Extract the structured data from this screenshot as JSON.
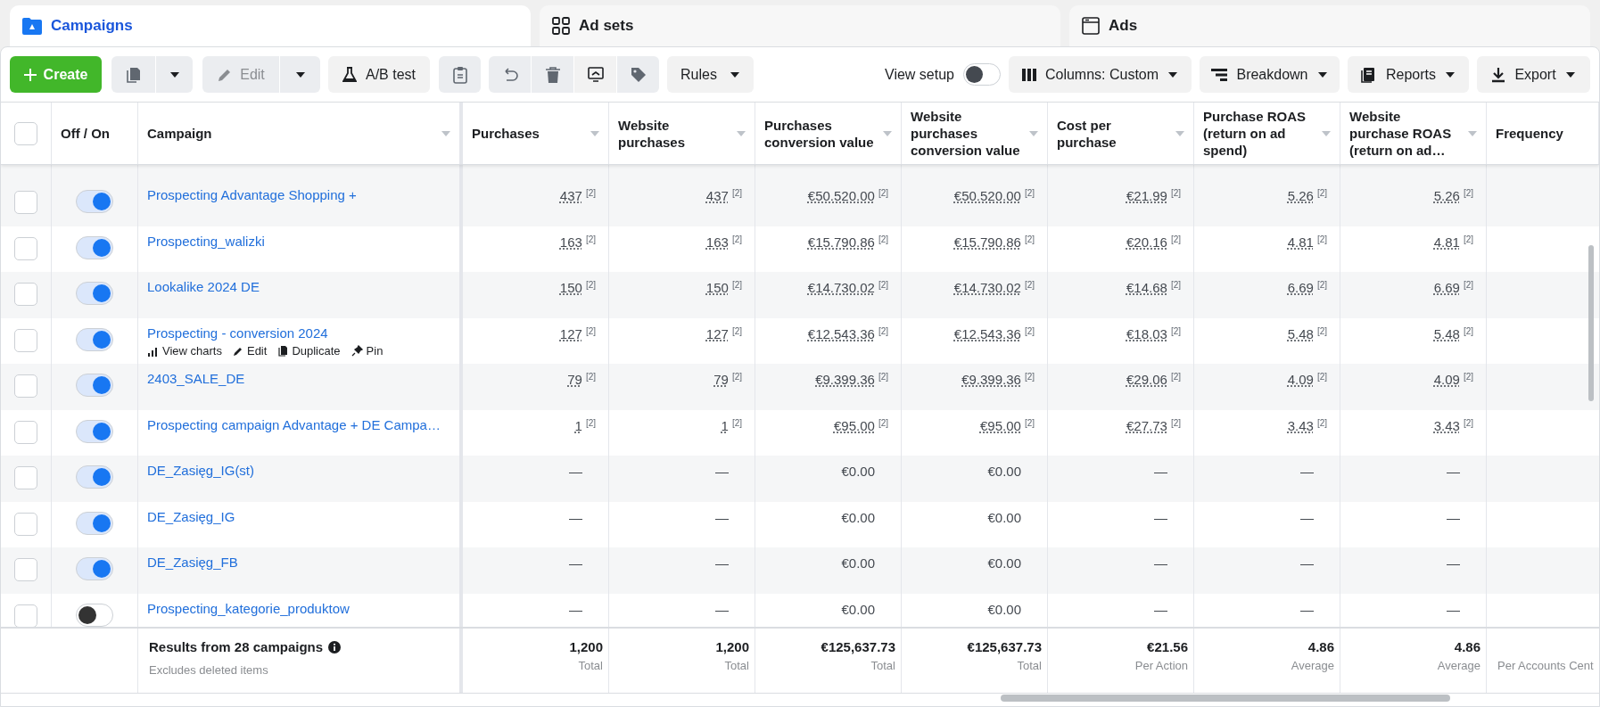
{
  "tabs": [
    {
      "label": "Campaigns",
      "selected": true
    },
    {
      "label": "Ad sets",
      "selected": false
    },
    {
      "label": "Ads",
      "selected": false
    }
  ],
  "toolbar": {
    "create": "Create",
    "edit": {
      "label": "Edit",
      "disabled": true
    },
    "ab_test": "A/B test",
    "rules": "Rules",
    "view_setup": {
      "label": "View setup",
      "on": false
    },
    "right_buttons": [
      "Columns: Custom",
      "Breakdown",
      "Reports",
      "Export"
    ]
  },
  "table": {
    "header_checkbox": {
      "checked": false
    },
    "toggle_header": {
      "label": "Off / On",
      "sortable": false
    },
    "name_header": {
      "label": "Campaign",
      "sortable": true
    },
    "columns": [
      {
        "label": "Purchases",
        "sortable": true
      },
      {
        "label": "Website purchases",
        "sortable": true
      },
      {
        "label": "Purchases conversion value",
        "sortable": true
      },
      {
        "label": "Website purchases conversion value",
        "sortable": true
      },
      {
        "label": "Cost per purchase",
        "sortable": true
      },
      {
        "label": "Purchase ROAS (return on ad spend)",
        "sortable": true
      },
      {
        "label": "Website purchase ROAS (return on ad…",
        "sortable": true
      },
      {
        "label": "Frequency",
        "sortable": false
      }
    ],
    "rows": [
      {
        "name": "Prospecting Advantage Shopping +",
        "on": true,
        "checked": false,
        "cells": [
          {
            "value": "437",
            "note": "[2]"
          },
          {
            "value": "437",
            "note": "[2]"
          },
          {
            "value": "€50.520.00",
            "note": "[2]"
          },
          {
            "value": "€50.520.00",
            "note": "[2]"
          },
          {
            "value": "€21.99",
            "note": "[2]"
          },
          {
            "value": "5.26",
            "note": "[2]"
          },
          {
            "value": "5.26",
            "note": "[2]"
          }
        ]
      },
      {
        "name": "Prospecting_walizki",
        "on": true,
        "checked": false,
        "cells": [
          {
            "value": "163",
            "note": "[2]"
          },
          {
            "value": "163",
            "note": "[2]"
          },
          {
            "value": "€15.790.86",
            "note": "[2]"
          },
          {
            "value": "€15.790.86",
            "note": "[2]"
          },
          {
            "value": "€20.16",
            "note": "[2]"
          },
          {
            "value": "4.81",
            "note": "[2]"
          },
          {
            "value": "4.81",
            "note": "[2]"
          }
        ]
      },
      {
        "name": "Lookalike 2024 DE",
        "on": true,
        "checked": false,
        "cells": [
          {
            "value": "150",
            "note": "[2]"
          },
          {
            "value": "150",
            "note": "[2]"
          },
          {
            "value": "€14.730.02",
            "note": "[2]"
          },
          {
            "value": "€14.730.02",
            "note": "[2]"
          },
          {
            "value": "€14.68",
            "note": "[2]"
          },
          {
            "value": "6.69",
            "note": "[2]"
          },
          {
            "value": "6.69",
            "note": "[2]"
          }
        ]
      },
      {
        "name": "Prospecting - conversion 2024",
        "on": true,
        "checked": false,
        "actions": [
          "View charts",
          "Edit",
          "Duplicate",
          "Pin"
        ],
        "cells": [
          {
            "value": "127",
            "note": "[2]"
          },
          {
            "value": "127",
            "note": "[2]"
          },
          {
            "value": "€12.543.36",
            "note": "[2]"
          },
          {
            "value": "€12.543.36",
            "note": "[2]"
          },
          {
            "value": "€18.03",
            "note": "[2]"
          },
          {
            "value": "5.48",
            "note": "[2]"
          },
          {
            "value": "5.48",
            "note": "[2]"
          }
        ]
      },
      {
        "name": "2403_SALE_DE",
        "on": true,
        "checked": false,
        "cells": [
          {
            "value": "79",
            "note": "[2]"
          },
          {
            "value": "79",
            "note": "[2]"
          },
          {
            "value": "€9.399.36",
            "note": "[2]"
          },
          {
            "value": "€9.399.36",
            "note": "[2]"
          },
          {
            "value": "€29.06",
            "note": "[2]"
          },
          {
            "value": "4.09",
            "note": "[2]"
          },
          {
            "value": "4.09",
            "note": "[2]"
          }
        ]
      },
      {
        "name": "Prospecting campaign Advantage + DE Campa…",
        "on": true,
        "checked": false,
        "cells": [
          {
            "value": "1",
            "note": "[2]"
          },
          {
            "value": "1",
            "note": "[2]"
          },
          {
            "value": "€95.00",
            "note": "[2]"
          },
          {
            "value": "€95.00",
            "note": "[2]"
          },
          {
            "value": "€27.73",
            "note": "[2]"
          },
          {
            "value": "3.43",
            "note": "[2]"
          },
          {
            "value": "3.43",
            "note": "[2]"
          }
        ]
      },
      {
        "name": "DE_Zasięg_IG(st)",
        "on": true,
        "checked": false,
        "cells": [
          {
            "value": "—"
          },
          {
            "value": "—"
          },
          {
            "value": "€0.00"
          },
          {
            "value": "€0.00"
          },
          {
            "value": "—"
          },
          {
            "value": "—"
          },
          {
            "value": "—"
          }
        ]
      },
      {
        "name": "DE_Zasięg_IG",
        "on": true,
        "checked": false,
        "cells": [
          {
            "value": "—"
          },
          {
            "value": "—"
          },
          {
            "value": "€0.00"
          },
          {
            "value": "€0.00"
          },
          {
            "value": "—"
          },
          {
            "value": "—"
          },
          {
            "value": "—"
          }
        ]
      },
      {
        "name": "DE_Zasięg_FB",
        "on": true,
        "checked": false,
        "cells": [
          {
            "value": "—"
          },
          {
            "value": "—"
          },
          {
            "value": "€0.00"
          },
          {
            "value": "€0.00"
          },
          {
            "value": "—"
          },
          {
            "value": "—"
          },
          {
            "value": "—"
          }
        ]
      },
      {
        "name": "Prospecting_kategorie_produktow",
        "on": false,
        "checked": false,
        "cells": [
          {
            "value": "—"
          },
          {
            "value": "—"
          },
          {
            "value": "€0.00"
          },
          {
            "value": "€0.00"
          },
          {
            "value": "—"
          },
          {
            "value": "—"
          },
          {
            "value": "—"
          }
        ]
      }
    ],
    "summary": {
      "title": "Results from 28 campaigns",
      "subtitle": "Excludes deleted items",
      "totals": [
        {
          "value": "1,200",
          "label": "Total"
        },
        {
          "value": "1,200",
          "label": "Total"
        },
        {
          "value": "€125,637.73",
          "label": "Total"
        },
        {
          "value": "€125,637.73",
          "label": "Total"
        },
        {
          "value": "€21.56",
          "label": "Per Action"
        },
        {
          "value": "4.86",
          "label": "Average"
        },
        {
          "value": "4.86",
          "label": "Average"
        },
        {
          "label": "Per Accounts Cent"
        }
      ]
    }
  }
}
